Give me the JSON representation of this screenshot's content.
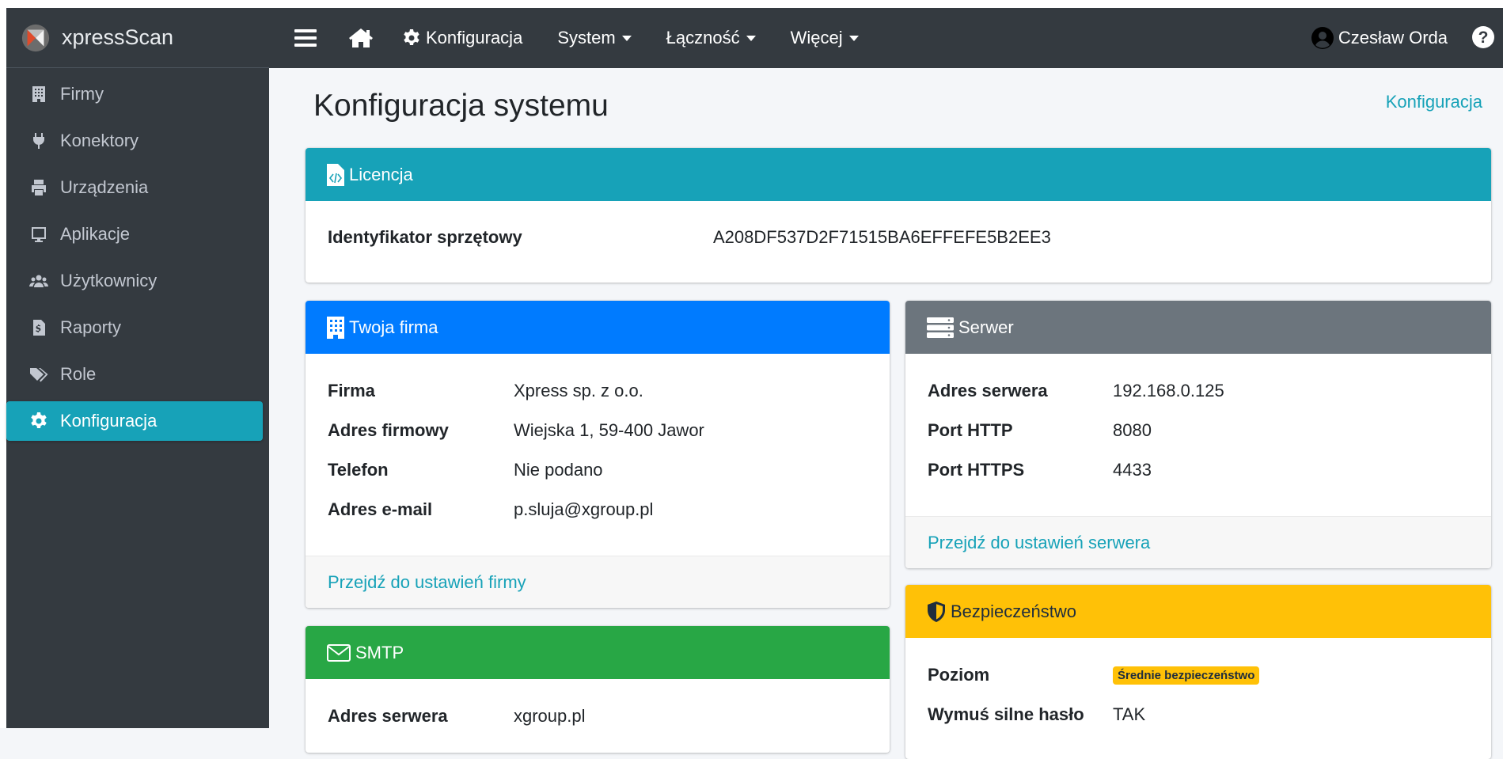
{
  "brand": {
    "name": "xpressScan"
  },
  "sidebar": {
    "items": [
      {
        "label": "Firmy",
        "icon": "building-icon"
      },
      {
        "label": "Konektory",
        "icon": "plug-icon"
      },
      {
        "label": "Urządzenia",
        "icon": "printer-icon"
      },
      {
        "label": "Aplikacje",
        "icon": "tablet-icon"
      },
      {
        "label": "Użytkownicy",
        "icon": "users-icon"
      },
      {
        "label": "Raporty",
        "icon": "report-icon"
      },
      {
        "label": "Role",
        "icon": "tags-icon"
      },
      {
        "label": "Konfiguracja",
        "icon": "gear-icon",
        "active": true
      }
    ]
  },
  "topbar": {
    "config_label": "Konfiguracja",
    "system_label": "System",
    "connectivity_label": "Łączność",
    "more_label": "Więcej",
    "user_name": "Czesław Orda"
  },
  "page": {
    "title": "Konfiguracja systemu",
    "breadcrumb": "Konfiguracja"
  },
  "license": {
    "header": "Licencja",
    "hw_id_label": "Identyfikator sprzętowy",
    "hw_id_value": "A208DF537D2F71515BA6EFFEFE5B2EE3"
  },
  "company": {
    "header": "Twoja firma",
    "rows": [
      {
        "k": "Firma",
        "v": "Xpress sp. z o.o."
      },
      {
        "k": "Adres firmowy",
        "v": "Wiejska 1, 59-400 Jawor"
      },
      {
        "k": "Telefon",
        "v": "Nie podano"
      },
      {
        "k": "Adres e-mail",
        "v": "p.sluja@xgroup.pl"
      }
    ],
    "footer": "Przejdź do ustawień firmy"
  },
  "server": {
    "header": "Serwer",
    "rows": [
      {
        "k": "Adres serwera",
        "v": "192.168.0.125"
      },
      {
        "k": "Port HTTP",
        "v": "8080"
      },
      {
        "k": "Port HTTPS",
        "v": "4433"
      }
    ],
    "footer": "Przejdź do ustawień serwera"
  },
  "smtp": {
    "header": "SMTP",
    "rows": [
      {
        "k": "Adres serwera",
        "v": "xgroup.pl"
      }
    ]
  },
  "security": {
    "header": "Bezpieczeństwo",
    "level_label": "Poziom",
    "level_badge": "Średnie bezpieczeństwo",
    "strong_pw_label": "Wymuś silne hasło",
    "strong_pw_value": "TAK"
  },
  "colors": {
    "sidebar_bg": "#343a40",
    "info": "#17a2b8",
    "primary": "#007bff",
    "secondary": "#6c757d",
    "success": "#28a745",
    "warning": "#ffc107"
  }
}
